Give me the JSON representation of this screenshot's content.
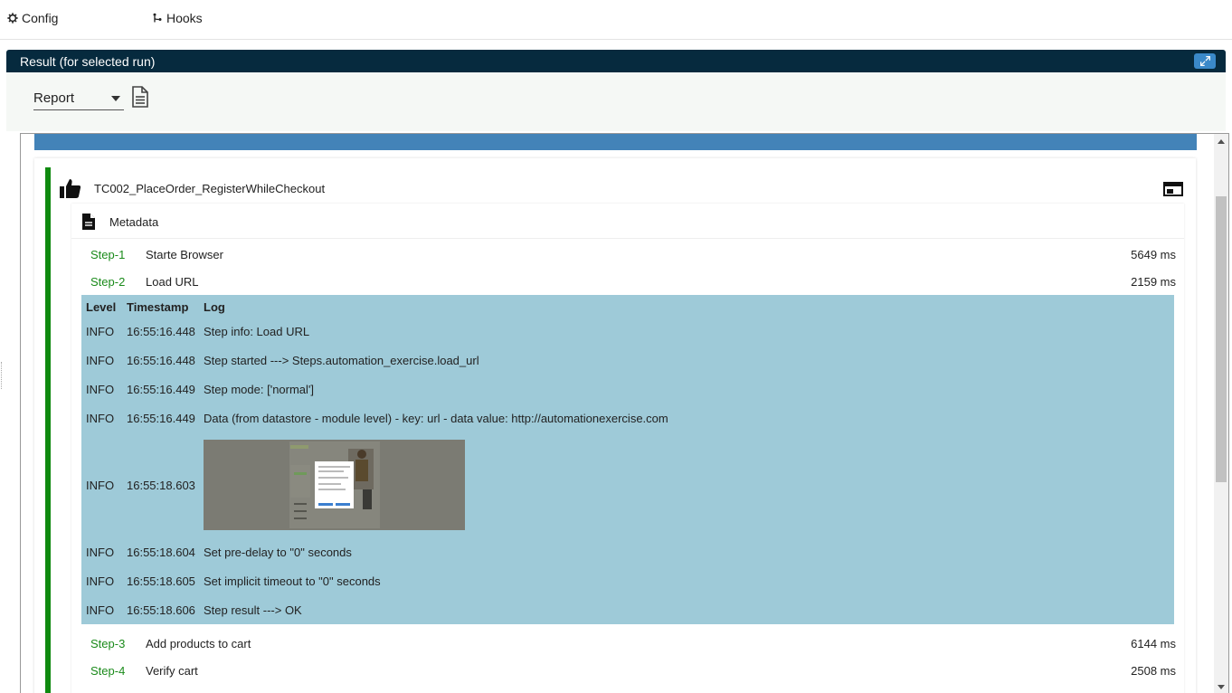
{
  "top_tabs": [
    {
      "label": "Config",
      "icon": "gear-icon"
    },
    {
      "label": "Hooks",
      "icon": "hooks-icon"
    }
  ],
  "result_panel": {
    "title": "Result (for selected run)",
    "view_select": {
      "selected": "Report"
    }
  },
  "testcase": {
    "title": "TC002_PlaceOrder_RegisterWhileCheckout",
    "status_icon": "thumbs-up-icon",
    "metadata_label": "Metadata"
  },
  "steps": [
    {
      "num": "Step-1",
      "name": "Starte Browser",
      "duration": "5649 ms"
    },
    {
      "num": "Step-2",
      "name": "Load URL",
      "duration": "2159 ms"
    },
    {
      "num": "Step-3",
      "name": "Add products to cart",
      "duration": "6144 ms"
    },
    {
      "num": "Step-4",
      "name": "Verify cart",
      "duration": "2508 ms"
    }
  ],
  "log": {
    "headers": {
      "level": "Level",
      "timestamp": "Timestamp",
      "log": "Log"
    },
    "rows": [
      {
        "level": "INFO",
        "timestamp": "16:55:16.448",
        "message": "Step info: Load URL"
      },
      {
        "level": "INFO",
        "timestamp": "16:55:16.448",
        "message": "Step started ---> Steps.automation_exercise.load_url"
      },
      {
        "level": "INFO",
        "timestamp": "16:55:16.449",
        "message": "Step mode: ['normal']"
      },
      {
        "level": "INFO",
        "timestamp": "16:55:16.449",
        "message": "Data (from datastore - module level) - key: url - data value: http://automationexercise.com"
      },
      {
        "level": "INFO",
        "timestamp": "16:55:18.603",
        "message": ""
      },
      {
        "level": "INFO",
        "timestamp": "16:55:18.604",
        "message": "Set pre-delay to \"0\" seconds"
      },
      {
        "level": "INFO",
        "timestamp": "16:55:18.605",
        "message": "Set implicit timeout to \"0\" seconds"
      },
      {
        "level": "INFO",
        "timestamp": "16:55:18.606",
        "message": "Step result ---> OK"
      }
    ]
  },
  "colors": {
    "header_bg": "#062a3e",
    "status_green": "#0f8a0f",
    "log_bg": "#9ecad8",
    "band_blue": "#4383b8"
  }
}
